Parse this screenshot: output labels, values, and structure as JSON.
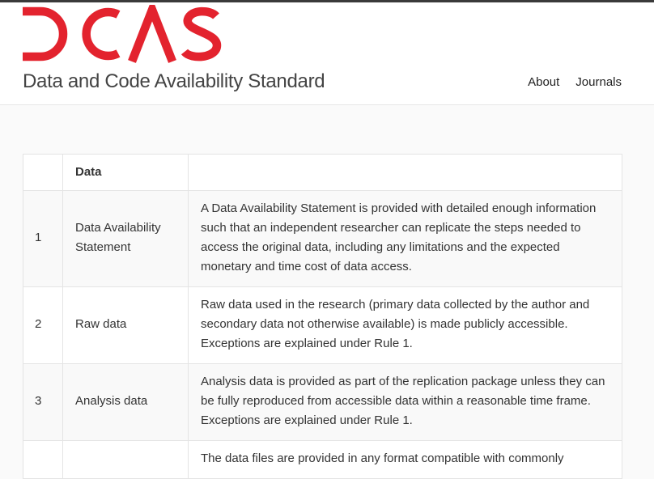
{
  "brand": {
    "logo_text": "DCAS",
    "logo_color": "#e3232e",
    "tagline": "Data and Code Availability Standard"
  },
  "nav": {
    "items": [
      {
        "label": "About"
      },
      {
        "label": "Journals"
      }
    ]
  },
  "table": {
    "header": {
      "num": "",
      "name": "Data",
      "desc": ""
    },
    "rows": [
      {
        "num": "1",
        "name": "Data Availability Statement",
        "desc": "A Data Availability Statement is provided with detailed enough information such that an independent researcher can replicate the steps needed to access the original data, including any limitations and the expected monetary and time cost of data access."
      },
      {
        "num": "2",
        "name": "Raw data",
        "desc": "Raw data used in the research (primary data collected by the author and secondary data not otherwise available) is made publicly accessible. Exceptions are explained under Rule 1."
      },
      {
        "num": "3",
        "name": "Analysis data",
        "desc": "Analysis data is provided as part of the replication package unless they can be fully reproduced from accessible data within a reasonable time frame. Exceptions are explained under Rule 1."
      },
      {
        "num": "",
        "name": "",
        "desc": "The data files are provided in any format compatible with commonly"
      }
    ]
  }
}
